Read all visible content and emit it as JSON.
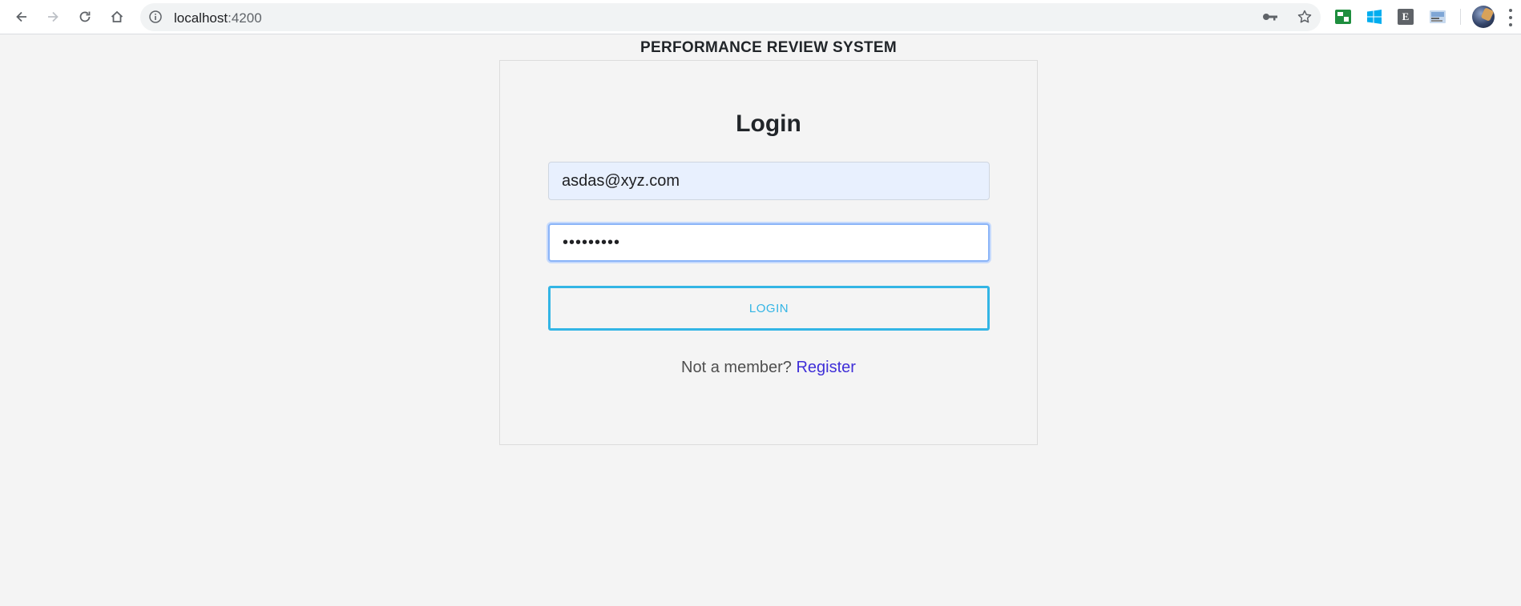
{
  "browser": {
    "url_host": "localhost",
    "url_port": ":4200",
    "icons": [
      "back-icon",
      "forward-icon",
      "reload-icon",
      "home-icon",
      "info-icon",
      "key-icon",
      "star-icon"
    ],
    "extensions": [
      "sheets-extension-icon",
      "windows-extension-icon",
      "e-extension-icon",
      "image-extension-icon"
    ],
    "extension_e_letter": "E"
  },
  "page": {
    "app_title": "PERFORMANCE REVIEW SYSTEM",
    "login_heading": "Login",
    "email_value": "asdas@xyz.com",
    "password_value": "•••••••••",
    "login_button_label": "LOGIN",
    "register_prompt": "Not a member?",
    "register_link": "Register"
  },
  "colors": {
    "page_background": "#f4f4f4",
    "accent": "#33b5e5",
    "link": "#3f2fd8",
    "autofill_background": "#e8f0fe"
  }
}
